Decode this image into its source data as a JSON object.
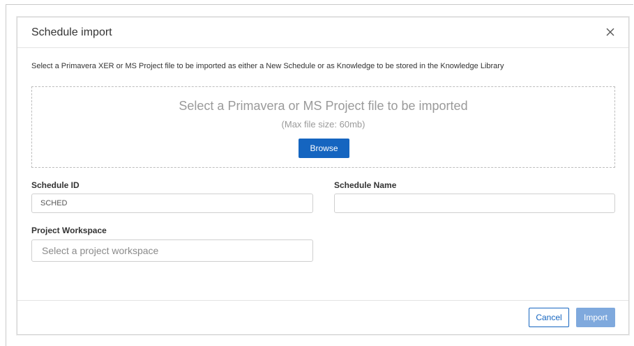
{
  "dialog": {
    "title": "Schedule import",
    "description": "Select a Primavera XER or MS Project file to be imported as either a New Schedule or as Knowledge to be stored in the Knowledge Library"
  },
  "dropzone": {
    "main_text": "Select a Primavera or MS Project file to be imported",
    "sub_text": "(Max file size: 60mb)",
    "browse_label": "Browse"
  },
  "form": {
    "schedule_id": {
      "label": "Schedule ID",
      "value": "SCHED"
    },
    "schedule_name": {
      "label": "Schedule Name",
      "value": ""
    },
    "project_workspace": {
      "label": "Project Workspace",
      "placeholder": "Select a project workspace"
    }
  },
  "footer": {
    "cancel_label": "Cancel",
    "import_label": "Import"
  },
  "colors": {
    "primary": "#1565c0",
    "primary_disabled": "#7fa9dd"
  },
  "icons": {
    "close": "close-icon"
  }
}
